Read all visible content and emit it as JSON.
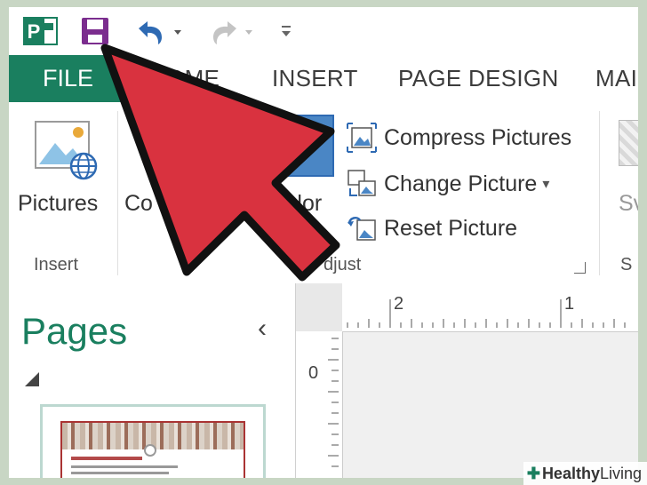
{
  "qat": {
    "app_icon_letter": "P",
    "icons": [
      "publisher-app-icon",
      "save-icon",
      "undo-icon",
      "redo-icon",
      "customize-qat-icon"
    ]
  },
  "tabs": {
    "file": "FILE",
    "home": "HOME",
    "insert": "INSERT",
    "page_design": "PAGE DESIGN",
    "mailings": "MAI"
  },
  "ribbon": {
    "insert_group": {
      "pictures_label": "Pictures",
      "group_label": "Insert"
    },
    "adjust_group": {
      "corrections_partial": "Co",
      "recolor_partial": "color",
      "group_label": "djust",
      "commands": [
        {
          "label": "Compress Pictures",
          "icon": "compress-pictures-icon"
        },
        {
          "label": "Change Picture",
          "icon": "change-picture-icon",
          "dropdown": "▾"
        },
        {
          "label": "Reset Picture",
          "icon": "reset-picture-icon"
        }
      ],
      "launcher": "⌟"
    },
    "styles_group": {
      "label_partial": "Sv",
      "group_partial": "S"
    }
  },
  "pages_pane": {
    "title": "Pages",
    "collapse": "‹"
  },
  "rulers": {
    "top_labels": [
      "2",
      "1"
    ],
    "left_labels": [
      "0"
    ]
  },
  "watermark": {
    "brand_bold": "Healthy",
    "brand_rest": " Living"
  },
  "colors": {
    "accent": "#1a7f5f",
    "arrow": "#d9323f",
    "save_icon": "#7b2d8e"
  }
}
